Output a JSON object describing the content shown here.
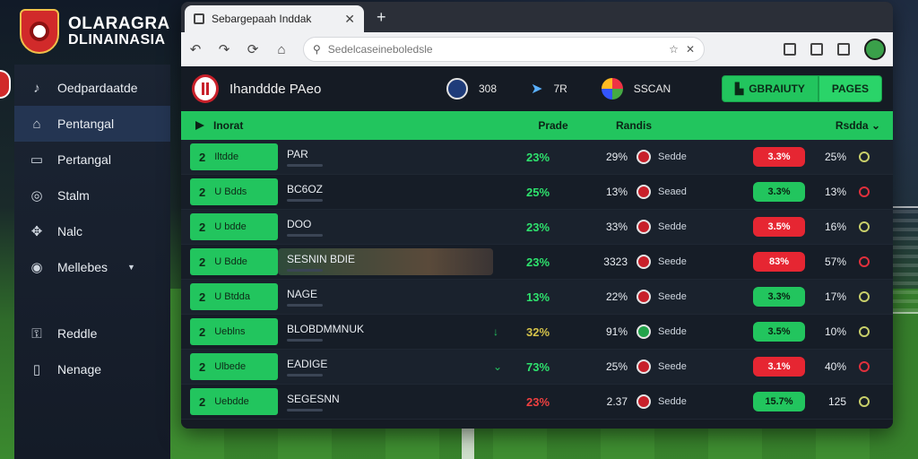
{
  "app": {
    "logo_line1": "OLARAGRA",
    "logo_line2": "DLINAINASIA"
  },
  "sidebar": {
    "items": [
      {
        "label": "Oedpardaatde",
        "icon": "whistle-icon"
      },
      {
        "label": "Pentangal",
        "icon": "home-icon"
      },
      {
        "label": "Pertangal",
        "icon": "chart-icon"
      },
      {
        "label": "Stalm",
        "icon": "ball-icon"
      },
      {
        "label": "Nalc",
        "icon": "puzzle-icon"
      },
      {
        "label": "Mellebes",
        "icon": "settings-icon"
      },
      {
        "label": "Reddle",
        "icon": "lock-icon"
      },
      {
        "label": "Nenage",
        "icon": "folder-icon"
      }
    ]
  },
  "browser": {
    "tab_title": "Sebargepaah Inddak",
    "address_placeholder": "Sedelcaseineboledsle"
  },
  "match": {
    "title": "Ihanddde PAeo",
    "stat1": "308",
    "stat2": "7R",
    "stat3": "SSCAN",
    "btn_left": "GBRAIUTY",
    "btn_right": "PAGES"
  },
  "table": {
    "header_first": "Inorat",
    "header_a": "Prade",
    "header_b": "Randis",
    "header_c": "Rsdda"
  },
  "rows": [
    {
      "num": "2",
      "tag": "Iltdde",
      "name": "PAR",
      "trend": "",
      "p1": "23%",
      "p1c": "green",
      "p2": "29%",
      "team": "Sedde",
      "tl": "r",
      "odds": "3.3%",
      "oc": "red",
      "p3": "25%",
      "dot": ""
    },
    {
      "num": "2",
      "tag": "U Bdds",
      "name": "BC6OZ",
      "trend": "",
      "p1": "25%",
      "p1c": "green",
      "p2": "13%",
      "team": "Seaed",
      "tl": "r",
      "odds": "3.3%",
      "oc": "green",
      "p3": "13%",
      "dot": "red"
    },
    {
      "num": "2",
      "tag": "U bdde",
      "name": "DOO",
      "trend": "",
      "p1": "23%",
      "p1c": "green",
      "p2": "33%",
      "team": "Sedde",
      "tl": "r",
      "odds": "3.5%",
      "oc": "red",
      "p3": "16%",
      "dot": ""
    },
    {
      "num": "2",
      "tag": "U Bdde",
      "name": "SESNIN BDIE",
      "trend": "",
      "p1": "23%",
      "p1c": "green",
      "p2": "3323",
      "team": "Seede",
      "tl": "r",
      "odds": "83%",
      "oc": "red",
      "p3": "57%",
      "dot": "red",
      "highlight": true
    },
    {
      "num": "2",
      "tag": "U Btdda",
      "name": "NAGE",
      "trend": "",
      "p1": "13%",
      "p1c": "green",
      "p2": "22%",
      "team": "Seede",
      "tl": "r",
      "odds": "3.3%",
      "oc": "green",
      "p3": "17%",
      "dot": ""
    },
    {
      "num": "2",
      "tag": "Ueblns",
      "name": "BLOBDMMNUK",
      "trend": "↓",
      "p1": "32%",
      "p1c": "yellow",
      "p2": "91%",
      "team": "Sedde",
      "tl": "g",
      "odds": "3.5%",
      "oc": "green",
      "p3": "10%",
      "dot": ""
    },
    {
      "num": "2",
      "tag": "Ulbede",
      "name": "EADIGE",
      "trend": "⌄",
      "p1": "73%",
      "p1c": "green",
      "p2": "25%",
      "team": "Seede",
      "tl": "r",
      "odds": "3.1%",
      "oc": "red",
      "p3": "40%",
      "dot": "red"
    },
    {
      "num": "2",
      "tag": "Uebdde",
      "name": "SEGESNN",
      "trend": "",
      "p1": "23%",
      "p1c": "red",
      "p2": "2.37",
      "team": "Sedde",
      "tl": "r",
      "odds": "15.7%",
      "oc": "green",
      "p3": "125",
      "dot": ""
    }
  ]
}
